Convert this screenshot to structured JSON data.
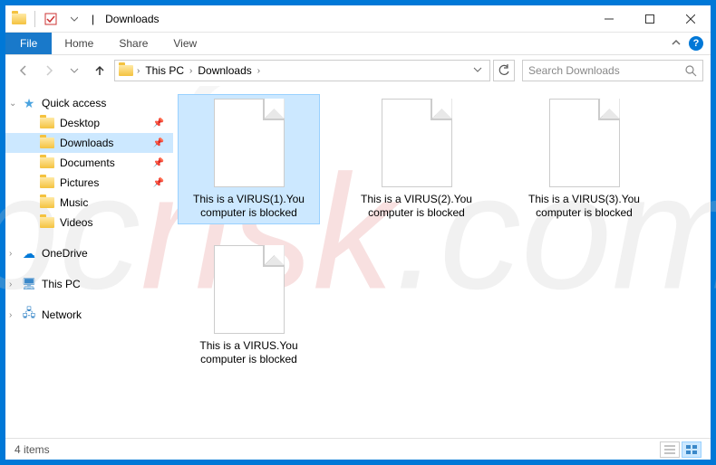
{
  "title": "Downloads",
  "titlebar_separator": "|",
  "ribbon": {
    "file": "File",
    "tabs": [
      "Home",
      "Share",
      "View"
    ]
  },
  "breadcrumb": {
    "root": "This PC",
    "current": "Downloads"
  },
  "search": {
    "placeholder": "Search Downloads"
  },
  "nav": {
    "quick_access": "Quick access",
    "items": [
      {
        "label": "Desktop",
        "pinned": true
      },
      {
        "label": "Downloads",
        "pinned": true,
        "selected": true
      },
      {
        "label": "Documents",
        "pinned": true
      },
      {
        "label": "Pictures",
        "pinned": true
      },
      {
        "label": "Music",
        "pinned": false
      },
      {
        "label": "Videos",
        "pinned": false
      }
    ],
    "onedrive": "OneDrive",
    "this_pc": "This PC",
    "network": "Network"
  },
  "files": [
    {
      "name": "This is a VIRUS(1).You computer is blocked",
      "selected": true
    },
    {
      "name": "This is a VIRUS(2).You computer is blocked",
      "selected": false
    },
    {
      "name": "This is a VIRUS(3).You computer is blocked",
      "selected": false
    },
    {
      "name": "This is a VIRUS.You computer is blocked",
      "selected": false
    }
  ],
  "status": {
    "count": "4 items"
  },
  "watermark": {
    "part1": "pc",
    "part2": "risk",
    "part3": ".com"
  }
}
